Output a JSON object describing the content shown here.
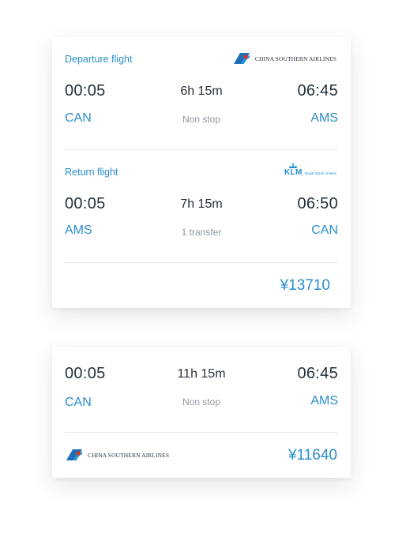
{
  "colors": {
    "accent": "#2a8fcb",
    "text_dark": "#23303c",
    "text_muted": "#8f979f",
    "divider": "#e8ebee"
  },
  "card1": {
    "departure": {
      "label": "Departure flight",
      "airline": {
        "name": "CHINA SOUTHERN AIRLINES",
        "icon": "china-southern-logo-icon"
      },
      "depart_time": "00:05",
      "arrive_time": "06:45",
      "duration": "6h 15m",
      "stops": "Non stop",
      "from": "CAN",
      "to": "AMS"
    },
    "return": {
      "label": "Return flight",
      "airline": {
        "name": "KLM",
        "subtitle": "Royal Dutch Airlines",
        "icon": "klm-logo-icon"
      },
      "depart_time": "00:05",
      "arrive_time": "06:50",
      "duration": "7h 15m",
      "stops": "1 transfer",
      "from": "AMS",
      "to": "CAN"
    },
    "price": "¥13710"
  },
  "card2": {
    "depart_time": "00:05",
    "arrive_time": "06:45",
    "duration": "11h 15m",
    "stops": "Non stop",
    "from": "CAN",
    "to": "AMS",
    "airline": {
      "name": "CHINA SOUTHERN AIRLINES",
      "icon": "china-southern-logo-icon"
    },
    "price": "¥11640"
  }
}
